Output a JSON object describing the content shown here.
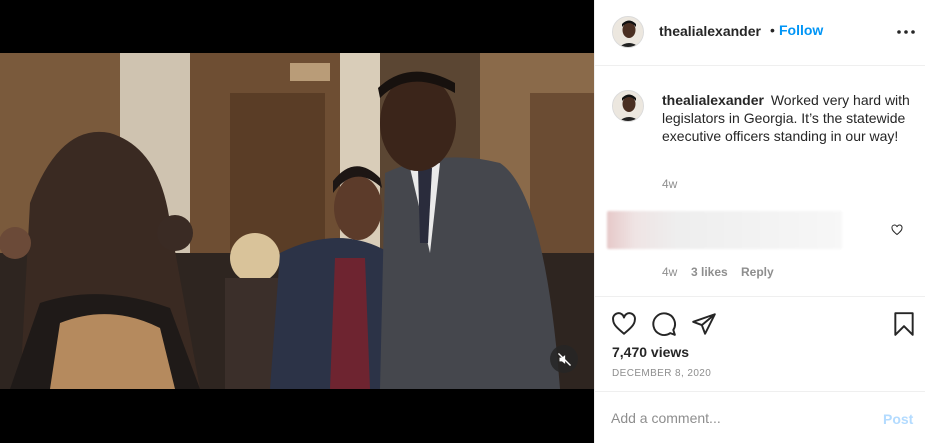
{
  "post": {
    "username": "thealialexander",
    "follow_separator": "•",
    "follow_label": "Follow",
    "caption": "Worked very hard with legislators in Georgia. It’s the statewide executive officers standing in our way!",
    "caption_time": "4w",
    "views": "7,470 views",
    "date": "December 8, 2020"
  },
  "comment": {
    "time": "4w",
    "likes": "3 likes",
    "reply_label": "Reply"
  },
  "composer": {
    "placeholder": "Add a comment...",
    "post_label": "Post"
  },
  "icons": {
    "more": "more-options-icon",
    "like": "heart-icon",
    "comment": "comment-icon",
    "share": "share-icon",
    "save": "bookmark-icon",
    "mute": "muted-speaker-icon"
  },
  "colors": {
    "accent": "#0095f6",
    "post_disabled": "#b3dbff",
    "muted_text": "#8e8e8e"
  }
}
